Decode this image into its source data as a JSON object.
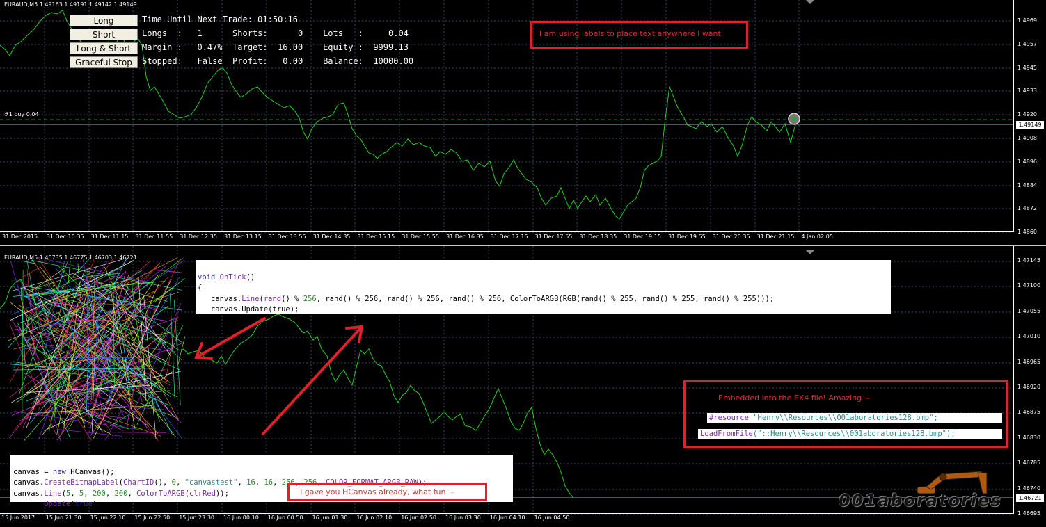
{
  "top_chart": {
    "symbol_header": "EURAUD,M5  1.49163 1.49191 1.49142 1.49149",
    "price_labels": [
      "1.4969",
      "1.4957",
      "1.4945",
      "1.4933",
      "1.4920",
      "1.4908",
      "1.4896",
      "1.4884",
      "1.4872",
      "1.4860"
    ],
    "current_price": "1.49149",
    "time_labels": [
      "31 Dec 2015",
      "31 Dec 10:35",
      "31 Dec 11:15",
      "31 Dec 11:55",
      "31 Dec 12:35",
      "31 Dec 13:15",
      "31 Dec 13:55",
      "31 Dec 14:35",
      "31 Dec 15:15",
      "31 Dec 15:55",
      "31 Dec 16:35",
      "31 Dec 17:15",
      "31 Dec 17:55",
      "31 Dec 18:35",
      "31 Dec 19:15",
      "31 Dec 19:55",
      "31 Dec 20:35",
      "31 Dec 21:15",
      "4 Jan 02:05"
    ],
    "order_label": "#1 buy 0.04",
    "buttons": {
      "long": "Long",
      "short": "Short",
      "long_short": "Long & Short",
      "graceful_stop": "Graceful Stop"
    },
    "info": {
      "line1": "Time Until Next Trade: 01:50:16",
      "line2": "Longs  :   1      Shorts:      0    Lots   :     0.04",
      "line3": "Margin :   0.47%  Target:  16.00    Equity :  9999.13",
      "line4": "Stopped:   False  Profit:   0.00    Balance:  10000.00"
    },
    "label_note": "I am using labels to place text anywhere I want"
  },
  "bottom_chart": {
    "symbol_header": "EURAUD,M5  1.46735 1.46775 1.46703 1.46721",
    "price_labels": [
      "1.47145",
      "1.47100",
      "1.47055",
      "1.47010",
      "1.46965",
      "1.46920",
      "1.46875",
      "1.46830",
      "1.46785",
      "1.46740",
      "1.46695"
    ],
    "current_price": "1.46721",
    "time_labels": [
      "15 Jun 2017",
      "15 Jun 21:30",
      "15 Jun 22:10",
      "15 Jun 22:50",
      "15 Jun 23:30",
      "16 Jun 00:10",
      "16 Jun 00:50",
      "16 Jun 01:30",
      "16 Jun 02:10",
      "16 Jun 02:50",
      "16 Jun 03:30",
      "16 Jun 04:10",
      "16 Jun 04:50"
    ],
    "ontick_code": {
      "l1_kw": "void",
      "l1_fn": "OnTick",
      "l1_rest": "()",
      "l2": "{",
      "l3a": "   canvas.",
      "l3b": "Line",
      "l3c": "(",
      "l3d": "rand",
      "l3e": "() % ",
      "l3f": "256",
      "l3_full": ", rand() % 256, rand() % 256, rand() % 256, ColorToARGB(RGB(rand() % 255, rand() % 255, rand() % 255)));",
      "l4": "   canvas.Update(true);",
      "l5": "}"
    },
    "hcanvas_code": {
      "l1a": "canvas = ",
      "l1b": "new",
      "l1c": " HCanvas();",
      "l2a": "canvas.",
      "l2b": "CreateBitmapLabel",
      "l2c": "(",
      "l2d": "ChartID",
      "l2e": "(), ",
      "l2f": "0",
      "l2g": ", ",
      "l2h": "\"canvastest\"",
      "l2i": ", ",
      "l2j": "16",
      "l2k": ", ",
      "l2l": "16",
      "l2m": ", ",
      "l2n": "256",
      "l2o": ", ",
      "l2p": "256",
      "l2q": ", ",
      "l2r": "COLOR_FORMAT_ARGB_RAW",
      "l2s": ");",
      "l3a": "canvas.",
      "l3b": "Line",
      "l3c": "(",
      "l3d": "5",
      "l3e": ", ",
      "l3f": "5",
      "l3g": ", ",
      "l3h": "200",
      "l3i": ", ",
      "l3j": "200",
      "l3k": ", ",
      "l3l": "ColorToARGB",
      "l3m": "(",
      "l3n": "clrRed",
      "l3o": "));",
      "l4a": "canvas.",
      "l4b": "Update",
      "l4c": "(",
      "l4d": "true",
      "l4e": ");"
    },
    "hcanvas_note": "I gave you HCanvas already, what fun ~",
    "embed_note": "Embedded into the EX4 file! Amazing ~",
    "resource_code": {
      "a": "#resource",
      "b": " \"Henry\\\\Resources\\\\001aboratories128.bmp\";"
    },
    "load_code": {
      "a": "LoadFromFile",
      "b": "(\"::Henry\\\\Resources\\\\001aboratories128.bmp\");"
    },
    "logo_text": "001aboratories"
  },
  "colors": {
    "price_line": "#22d422",
    "annotation": "#e0202a",
    "grid": "#3a4a6a",
    "order_line": "#1f8a2a"
  }
}
